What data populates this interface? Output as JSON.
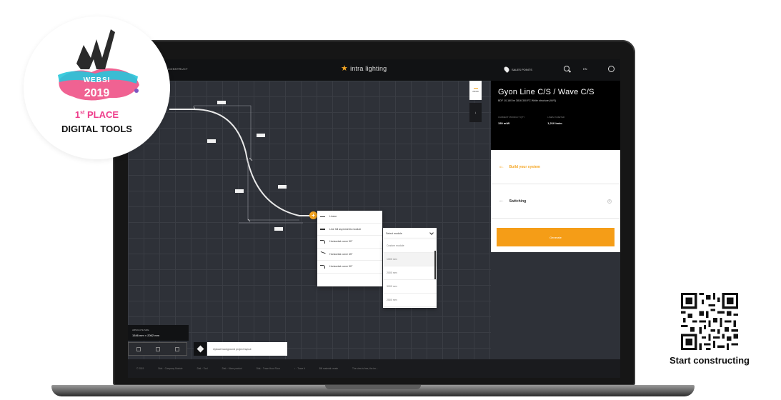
{
  "app": {
    "brand": "intra lighting",
    "nav_left": "CONSTRUCT",
    "sales_points": "SALES POINTS",
    "language": "EN"
  },
  "view_controls": [
    {
      "label": "2D/3D"
    },
    {
      "label": "⇩"
    }
  ],
  "canvas": {
    "dimension_labels": [
      "",
      "",
      "",
      "",
      "",
      "",
      ""
    ]
  },
  "menu": {
    "items": [
      {
        "label": "Linear",
        "icon": "line-icon"
      },
      {
        "label": "Line hill asymmetric module",
        "icon": "line-icon"
      },
      {
        "label": "Horizontal curve 90°",
        "icon": "curve-icon"
      },
      {
        "label": "Horizontal curve 45°",
        "icon": "diag-icon"
      },
      {
        "label": "Horizontal curve 90°",
        "icon": "curve-icon"
      }
    ]
  },
  "select": {
    "placeholder": "Select module",
    "options": [
      "Custom module",
      "1000 mm",
      "2000 mm",
      "3000 mm",
      "2500 mm"
    ]
  },
  "panel": {
    "title": "Gyon Line C/S / Wave C/S",
    "subtitle": "BDF 10,160 lm 3816 300 FC White structure (W/S)",
    "stats": [
      {
        "label": "CURRENT PRODUCT QTY",
        "value": "150 m/W"
      },
      {
        "label": "LINES IN METER",
        "value": "1,210 lm/m"
      }
    ],
    "steps": [
      {
        "num": "01.",
        "label": "Build your system",
        "active": true
      },
      {
        "num": "02.",
        "label": "Switching",
        "active": false
      }
    ],
    "button": "Generate"
  },
  "bottom": {
    "abs_label": "ABSOLUTE SIZE",
    "abs_value": "1546 mm × 2062 mm",
    "upload": "Upload background project layout",
    "footer_items": [
      "© 2019",
      "DiaL · Company Module",
      "DiaL · Tool",
      "DiaL · More product",
      "DiaL · Trace Hour Floor",
      "↕ · Trace it",
      "Bill material create",
      "The view is free, the ter..."
    ]
  },
  "award": {
    "websi": "WEBSI",
    "year": "2019",
    "place": "1",
    "place_suffix": "st",
    "place_word": "PLACE",
    "category": "DIGITAL TOOLS"
  },
  "qr": {
    "caption": "Start constructing"
  },
  "colors": {
    "accent": "#f5a623",
    "award_pink": "#ee3d8b"
  }
}
